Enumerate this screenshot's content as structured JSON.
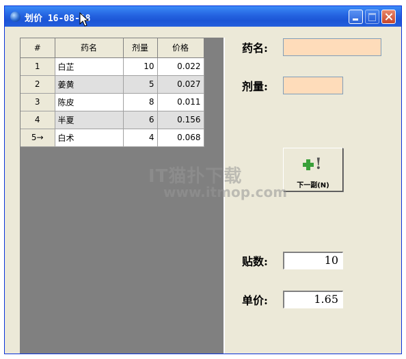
{
  "window": {
    "title": "划价  16-08-18"
  },
  "table": {
    "headers": [
      "#",
      "药名",
      "剂量",
      "价格"
    ],
    "rows": [
      {
        "no": "1",
        "name": "白芷",
        "dose": "10",
        "price": "0.022"
      },
      {
        "no": "2",
        "name": "姜黄",
        "dose": "5",
        "price": "0.027"
      },
      {
        "no": "3",
        "name": "陈皮",
        "dose": "8",
        "price": "0.011"
      },
      {
        "no": "4",
        "name": "半夏",
        "dose": "6",
        "price": "0.156"
      },
      {
        "no": "5→",
        "name": "白术",
        "dose": "4",
        "price": "0.068"
      }
    ]
  },
  "form": {
    "drug_name_label": "药名:",
    "drug_name_value": "",
    "dose_label": "剂量:",
    "dose_value": "",
    "next_button_label": "下一副(N)",
    "packets_label": "贴数:",
    "packets_value": "10",
    "unit_price_label": "单价:",
    "unit_price_value": "1.65"
  },
  "watermark": {
    "line1": "IT猫扑下载",
    "line2": "www.itmop.com"
  },
  "colors": {
    "title_bar": "#245fdc",
    "window_bg": "#ece9d8",
    "input_highlight": "#fedcba",
    "grid_panel": "#808080"
  },
  "icons": {
    "app": "app-globe-icon",
    "minimize": "minimize-icon",
    "maximize": "maximize-icon",
    "close": "close-icon",
    "next": "add-exclaim-icon"
  }
}
